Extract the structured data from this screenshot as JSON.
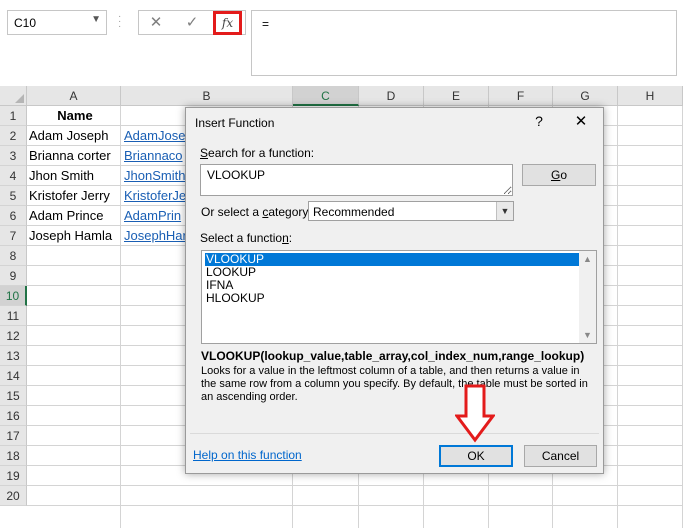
{
  "name_box": {
    "value": "C10"
  },
  "formula_bar": {
    "cancel_icon": "✕",
    "enter_icon": "✓",
    "fx_label": "fx",
    "content": "="
  },
  "columns": [
    "A",
    "B",
    "C",
    "D",
    "E",
    "F",
    "G",
    "H"
  ],
  "selected_column": "C",
  "rows": [
    "1",
    "2",
    "3",
    "4",
    "5",
    "6",
    "7",
    "8",
    "9",
    "10",
    "11",
    "12",
    "13",
    "14",
    "15",
    "16",
    "17",
    "18",
    "19",
    "20"
  ],
  "selected_row": "10",
  "sheet": {
    "header_a": "Name",
    "names": [
      "Adam Joseph",
      "Brianna corter",
      "Jhon Smith",
      "Kristofer Jerry",
      "Adam Prince",
      "Joseph Hamla"
    ],
    "links": [
      "AdamJose",
      "Briannaco",
      "JhonSmith",
      "KristoferJe",
      "AdamPrin",
      "JosephHar"
    ]
  },
  "dialog": {
    "title": "Insert Function",
    "help_icon": "?",
    "close_icon": "✕",
    "search_label_prefix": "",
    "search_label_key": "S",
    "search_label_rest": "earch for a function:",
    "search_value": "VLOOKUP",
    "go_label_key": "G",
    "go_label_rest": "o",
    "category_label_pre": "Or select a ",
    "category_label_key": "c",
    "category_label_rest": "ategory:",
    "category_value": "Recommended",
    "select_fn_label_pre": "Select a functio",
    "select_fn_label_key": "n",
    "select_fn_label_rest": ":",
    "functions": [
      "VLOOKUP",
      "LOOKUP",
      "IFNA",
      "HLOOKUP"
    ],
    "selected_function": "VLOOKUP",
    "syntax": "VLOOKUP(lookup_value,table_array,col_index_num,range_lookup)",
    "description": "Looks for a value in the leftmost column of a table, and then returns a value in the same row from a column you specify. By default, the table must be sorted in an ascending order.",
    "help_link": "Help on this function",
    "ok_label": "OK",
    "cancel_label": "Cancel"
  },
  "colors": {
    "accent_red": "#e31b1b",
    "excel_green": "#217346",
    "selection_blue": "#0078d7",
    "link_blue": "#1a5fb4"
  }
}
